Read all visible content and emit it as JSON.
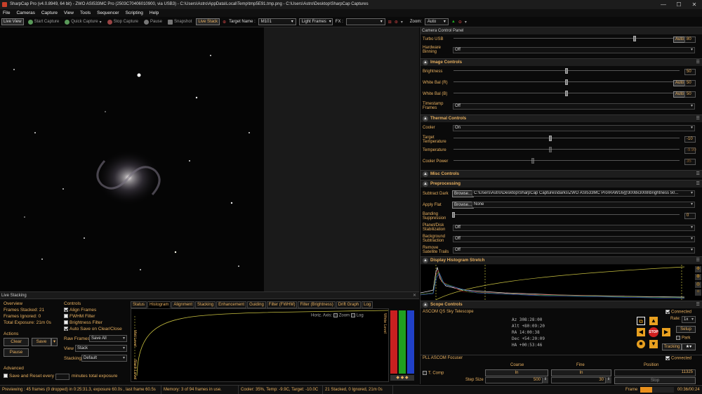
{
  "window": {
    "title": "SharpCap Pro (v4.0.8949, 64 bit) - ZWO ASI533MC Pro (2503C70406010900, via USB3) - C:\\Users\\Astro\\AppData\\Local\\Temp\\tmp5E91.tmp.png - C:\\Users\\Astro\\Desktop\\SharpCap Captures",
    "minimize": "—",
    "maximize": "☐",
    "close": "✕"
  },
  "menu": [
    "File",
    "Cameras",
    "Capture",
    "View",
    "Tools",
    "Sequencer",
    "Scripting",
    "Help"
  ],
  "toolbar": {
    "live_view": "Live View",
    "start_capture": "Start Capture",
    "quick_capture": "Quick Capture",
    "stop_capture": "Stop Capture",
    "pause": "Pause",
    "snapshot": "Snapshot",
    "live_stack": "Live Stack",
    "target_label": "Target Name :",
    "target_value": "M101",
    "frame_type": "Light Frames",
    "fx_label": "FX :",
    "fx_value": "",
    "zoom_label": "Zoom:",
    "zoom_value": "Auto"
  },
  "live_stacking": {
    "header": "Live Stacking",
    "overview_title": "Overview",
    "frames_stacked": "Frames Stacked: 21",
    "frames_ignored": "Frames Ignored: 0",
    "total_exposure": "Total Exposure: 21m 0s",
    "actions_title": "Actions",
    "clear": "Clear",
    "save": "Save",
    "pause": "Pause",
    "advanced_title": "Advanced",
    "save_reset_label": "Save and Reset every",
    "save_reset_suffix": "minutes total exposure",
    "controls_title": "Controls",
    "align_frames": "Align Frames",
    "fwhm_filter": "FWHM Filter",
    "brightness_filter": "Brightness Filter",
    "autosave": "Auto Save on Clear/Close",
    "raw_frames_label": "Raw Frames",
    "raw_frames_value": "Save All",
    "view_label": "View",
    "view_value": "Stack",
    "stacking_label": "Stacking",
    "stacking_value": "Default",
    "tabs": [
      "Status",
      "Histogram",
      "Alignment",
      "Stacking",
      "Enhancement",
      "Guiding",
      "Filter (FWHM)",
      "Filter (Brightness)",
      "Drift Graph",
      "Log"
    ],
    "selected_tab": "Histogram",
    "horiz_axis": "Horiz. Axis:",
    "zoom": "Zoom",
    "log": "Log",
    "mid_level": "Mid Level",
    "black_level": "Black Level",
    "white_level": "White Level"
  },
  "camera_panel": {
    "title": "Camera Control Panel",
    "turbo_usb": {
      "label": "Turbo USB",
      "auto": "Auto",
      "value": "80",
      "level": 0.8
    },
    "hardware_binning": {
      "label": "Hardware Binning",
      "value": "Off"
    },
    "image_controls": "Image Controls",
    "brightness": {
      "label": "Brightness",
      "value": "50",
      "level": 0.5
    },
    "wb_r": {
      "label": "White Bal (R)",
      "auto": "Auto",
      "value": "50",
      "level": 0.5
    },
    "wb_b": {
      "label": "White Bal (B)",
      "auto": "Auto",
      "value": "50",
      "level": 0.5
    },
    "timestamp": {
      "label": "Timestamp Frames",
      "value": "Off"
    },
    "thermal_controls": "Thermal Controls",
    "cooler": {
      "label": "Cooler",
      "value": "On"
    },
    "target_temp": {
      "label": "Target Temperature",
      "value": "-10",
      "level": 0.43
    },
    "temperature": {
      "label": "Temperature",
      "value": "-9.90",
      "level": 0.43
    },
    "cooler_power": {
      "label": "Cooler Power",
      "value": "35",
      "level": 0.35
    },
    "misc_controls": "Misc Controls",
    "preprocessing": "Preprocessing",
    "subtract_dark": {
      "label": "Subtract Dark",
      "browse": "Browse...",
      "value": "C:\\Users\\Astro\\Desktop\\SharpCap Captures\\darks\\ZWO ASI533MC Pro\\RAW16@3008x3008\\brightness 50..."
    },
    "apply_flat": {
      "label": "Apply Flat",
      "browse": "Browse...",
      "value": "None"
    },
    "banding": {
      "label": "Banding Suppression",
      "value": "0",
      "level": 0
    },
    "planet_stab": {
      "label": "Planet/Disk Stabilization",
      "value": "Off"
    },
    "bg_sub": {
      "label": "Background Subtraction",
      "value": "Off"
    },
    "sat_trails": {
      "label": "Remove Satellite Trails",
      "value": "Off"
    },
    "display_histogram": "Display Histogram Stretch",
    "scope_controls": "Scope Controls",
    "ascom_name": "ASCOM QS Sky Telescope",
    "connected": "Connected",
    "az": "Az   308:28:00",
    "alt": "Alt  +80:09:20",
    "ra": "RA   14:00:38",
    "dec": "Dec  +54:20:09",
    "ha": "HA   +00:53:46",
    "rate_label": "Rate:",
    "rate_value": "1x",
    "setup": "Setup",
    "park": "Park",
    "tracking": "Tracking",
    "stop": "STOP",
    "focuser_name": "PLL ASCOM Focuser",
    "t_comp": "T. Comp",
    "coarse": "Coarse",
    "fine": "Fine",
    "position": "Position",
    "coarse_in": "In",
    "fine_in": "In",
    "position_value": "11325",
    "step_size": "Step Size",
    "coarse_step": "500",
    "fine_step": "30",
    "stop_btn": "Stop"
  },
  "status": {
    "preview": "Previewing : 45 frames (0 dropped) in 0:25:31.3, exposure 60.0s , last frame 60.5s",
    "memory": "Memory: 3 of 94 frames in use.",
    "cooler": "Cooler: 35%, Temp: -9.9C, Target: -10.0C",
    "stacked": "21 Stacked, 0 Ignored, 21m 0s",
    "frame_label": "Frame",
    "frame_progress": 0.35,
    "time": "00:36/00:24"
  },
  "colors": {
    "accent": "#e8b060",
    "progress": "#e8901c",
    "red": "#c82020",
    "green": "#20a020",
    "blue": "#2040c8"
  }
}
